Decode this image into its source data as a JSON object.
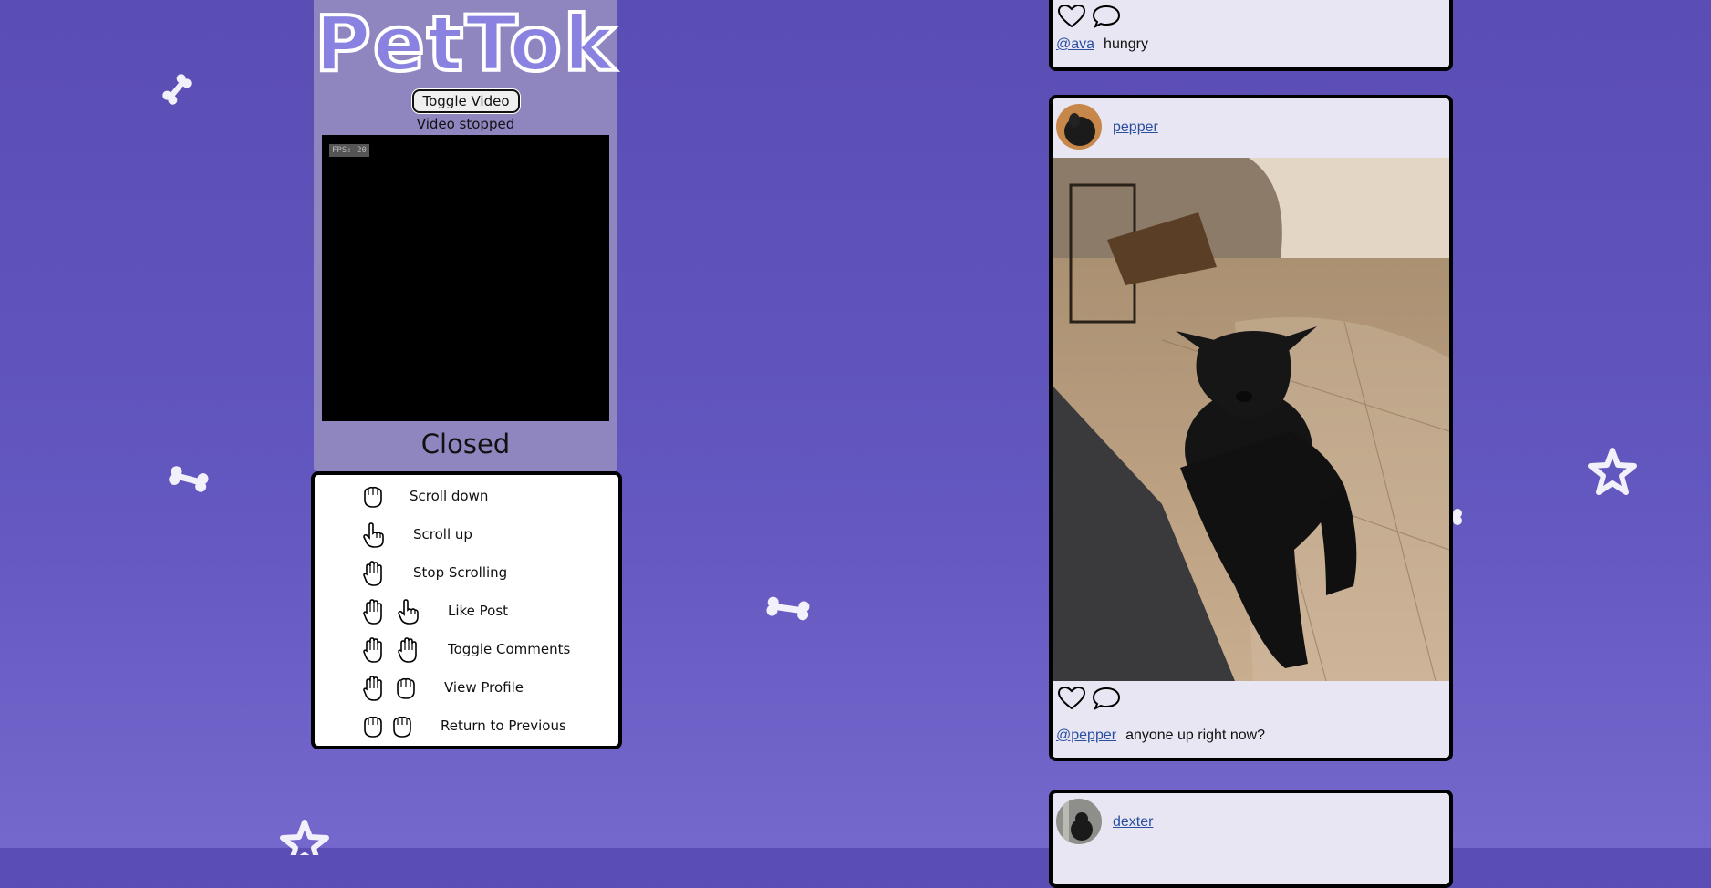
{
  "app": {
    "logo_text": "PetTok"
  },
  "video": {
    "toggle_label": "Toggle Video",
    "status": "Video stopped",
    "fps_label": "FPS: 20",
    "gesture_status": "Closed"
  },
  "gestures": [
    {
      "label": "Scroll down",
      "icons": [
        "closed-hand-icon"
      ]
    },
    {
      "label": "Scroll up",
      "icons": [
        "pointing-hand-icon"
      ]
    },
    {
      "label": "Stop Scrolling",
      "icons": [
        "open-hand-icon"
      ]
    },
    {
      "label": "Like Post",
      "icons": [
        "open-hand-icon",
        "pointing-hand-icon"
      ]
    },
    {
      "label": "Toggle Comments",
      "icons": [
        "open-hand-icon",
        "open-hand-icon"
      ]
    },
    {
      "label": "View Profile",
      "icons": [
        "open-hand-icon",
        "closed-hand-icon"
      ]
    },
    {
      "label": "Return to Previous",
      "icons": [
        "closed-hand-icon",
        "closed-hand-icon"
      ]
    }
  ],
  "feed": {
    "posts": [
      {
        "mention": "@ava",
        "caption": "hungry"
      },
      {
        "username": "pepper",
        "mention": "@pepper",
        "caption": "anyone up right now?"
      },
      {
        "username": "dexter"
      }
    ]
  },
  "colors": {
    "background": "#5a4db3",
    "panel": "#8f86bf",
    "card": "#e8e6f2",
    "link": "#2a4ea0"
  }
}
